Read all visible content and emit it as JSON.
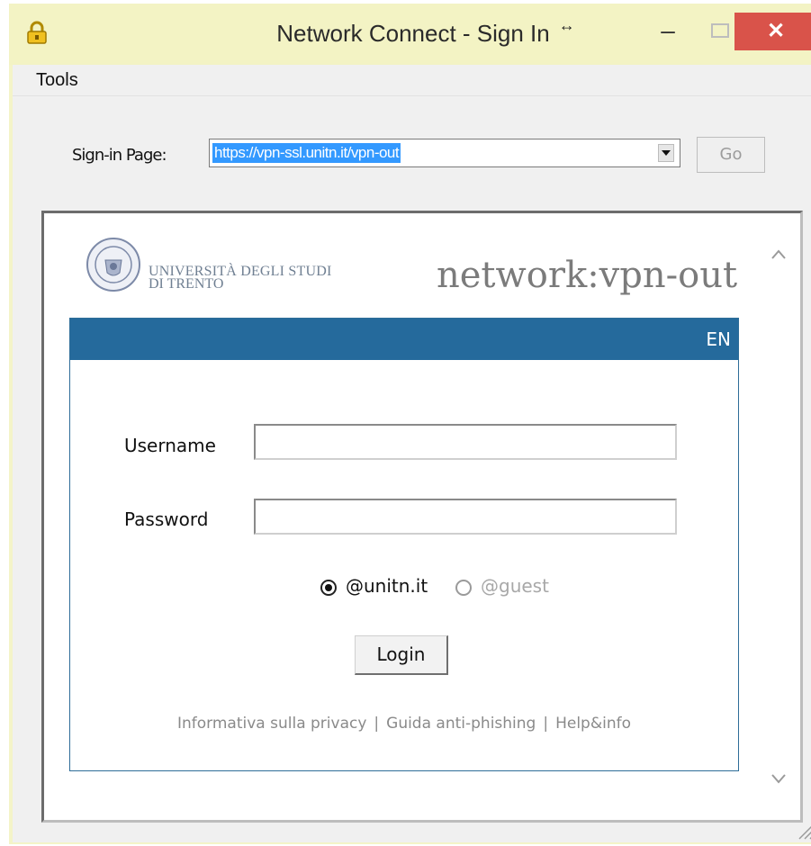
{
  "window": {
    "title": "Network Connect - Sign In",
    "title_suffix_glyph": "↔",
    "minimize_glyph": "–",
    "close_glyph": "✕"
  },
  "menu": {
    "items": [
      {
        "label": "Tools"
      }
    ]
  },
  "signin": {
    "label": "Sign-in Page:",
    "url": "https://vpn-ssl.unitn.it/vpn-out",
    "go_label": "Go"
  },
  "page": {
    "logo": {
      "line1": "UNIVERSITÀ DEGLI STUDI",
      "line2": "DI TRENTO"
    },
    "site_title": "network:vpn-out",
    "language": "EN",
    "form": {
      "username_label": "Username",
      "username_value": "",
      "password_label": "Password",
      "password_value": "",
      "realms": [
        {
          "label": "@unitn.it",
          "checked": true,
          "disabled": false
        },
        {
          "label": "@guest",
          "checked": false,
          "disabled": true
        }
      ],
      "login_label": "Login"
    },
    "footer_links": [
      {
        "label": "Informativa sulla privacy"
      },
      {
        "label": "Guida anti-phishing"
      },
      {
        "label": "Help&info"
      }
    ],
    "footer_separator": "|"
  },
  "icons": {
    "app": "lock-icon",
    "scroll_up": "chevron-up-icon",
    "scroll_down": "chevron-down-icon"
  },
  "colors": {
    "titlebar": "#f3f3c4",
    "close_button": "#d9534a",
    "panel_header": "#256a9c",
    "selection": "#3399ff"
  }
}
